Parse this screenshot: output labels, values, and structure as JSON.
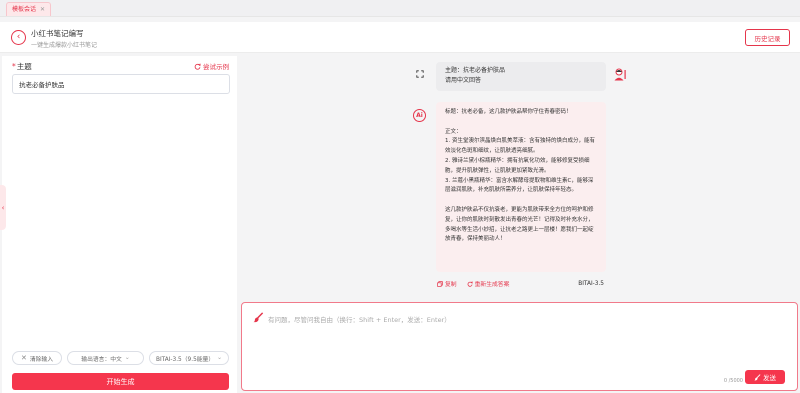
{
  "tabs": [
    {
      "label": "模板会话"
    }
  ],
  "header": {
    "title": "小红书笔记编写",
    "subtitle": "一键生成爆款小红书笔记",
    "history_label": "历史记录"
  },
  "form": {
    "topic_label": "主题",
    "example_label": "尝试示例",
    "topic_value": "抗老必备护肤品"
  },
  "controls": {
    "clear_label": "清除输入",
    "language_label": "输出语言：中文",
    "model_label": "BITAI-3.5（9.5能量）",
    "generate_label": "开始生成"
  },
  "chat": {
    "user_message": {
      "line1": "主题：抗老必备护肤品",
      "line2": "请用中文回答"
    },
    "ai_avatar_text": "Ai",
    "ai_message": {
      "title": "标题：抗老必备，这几款护肤品帮你守住青春密码！",
      "body_label": "正文：",
      "item1": "1. 资生堂澳尔滨晶焕白肌美萃液：含有独特的焕白成分，能有效淡化色斑和细纹，让肌肤透亮细腻。",
      "item2": "2. 雅诗兰黛小棕瓶精华：拥有抗氧化功效，能够修复受损细胞，提升肌肤弹性，让肌肤更加紧致光滑。",
      "item3": "3. 兰蔻小黑瓶精华：富含水解酵母提取物和维生素C，能够深层滋润肌肤，补充肌肤所需养分，让肌肤保持年轻态。",
      "closing": "这几款护肤品不仅抗衰老，更能为肌肤带来全方位的呵护和修复，让你的肌肤时刻散发出青春的光芒！记得及时补充水分，多喝水等生活小妙招，让抗老之路更上一层楼！愿我们一起绽放青春，保持美丽动人！"
    },
    "copy_label": "复制",
    "regenerate_label": "重新生成答案",
    "model_tag": "BITAI-3.5"
  },
  "composer": {
    "placeholder": "有问题，尽管问我自由（换行：Shift + Enter，发送：Enter）",
    "counter": "0 /5000",
    "send_label": "发送"
  },
  "colors": {
    "accent": "#f5364d",
    "accent_light": "#fde8ea",
    "ai_bubble": "#fbeeef",
    "user_bubble": "#ececee"
  }
}
